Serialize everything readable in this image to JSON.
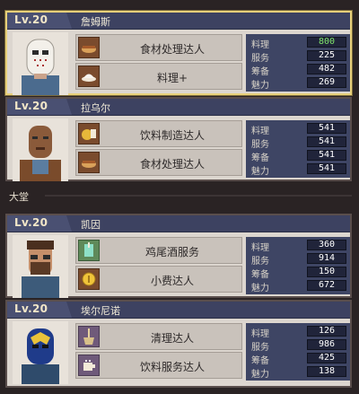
{
  "section_label": "大堂",
  "cards": [
    {
      "level": "Lv.20",
      "name": "詹姆斯",
      "portrait_icon": "hockey-mask-portrait",
      "skills": [
        {
          "label": "食材处理达人",
          "icon": "cooking-pan-icon"
        },
        {
          "label": "料理+",
          "icon": "dish-plate-icon"
        }
      ],
      "stats": [
        {
          "key": "料理",
          "value": "800",
          "highlight": true
        },
        {
          "key": "服务",
          "value": "225"
        },
        {
          "key": "筹备",
          "value": "482"
        },
        {
          "key": "魅力",
          "value": "269"
        }
      ]
    },
    {
      "level": "Lv.20",
      "name": "拉乌尔",
      "portrait_icon": "bald-man-portrait",
      "skills": [
        {
          "label": "饮料制造达人",
          "icon": "drink-cup-icon"
        },
        {
          "label": "食材处理达人",
          "icon": "cooking-pan-icon"
        }
      ],
      "stats": [
        {
          "key": "料理",
          "value": "541"
        },
        {
          "key": "服务",
          "value": "541"
        },
        {
          "key": "筹备",
          "value": "541"
        },
        {
          "key": "魅力",
          "value": "541"
        }
      ]
    },
    {
      "level": "Lv.20",
      "name": "凯因",
      "portrait_icon": "bearded-man-portrait",
      "skills": [
        {
          "label": "鸡尾酒服务",
          "icon": "cocktail-icon"
        },
        {
          "label": "小费达人",
          "icon": "coin-icon"
        }
      ],
      "stats": [
        {
          "key": "料理",
          "value": "360"
        },
        {
          "key": "服务",
          "value": "914"
        },
        {
          "key": "筹备",
          "value": "150"
        },
        {
          "key": "魅力",
          "value": "672"
        }
      ]
    },
    {
      "level": "Lv.20",
      "name": "埃尔尼诺",
      "portrait_icon": "luchador-mask-portrait",
      "skills": [
        {
          "label": "清理达人",
          "icon": "broom-icon"
        },
        {
          "label": "饮料服务达人",
          "icon": "coffee-cup-icon"
        }
      ],
      "stats": [
        {
          "key": "料理",
          "value": "126"
        },
        {
          "key": "服务",
          "value": "986"
        },
        {
          "key": "筹备",
          "value": "425"
        },
        {
          "key": "魅力",
          "value": "138"
        }
      ]
    }
  ]
}
